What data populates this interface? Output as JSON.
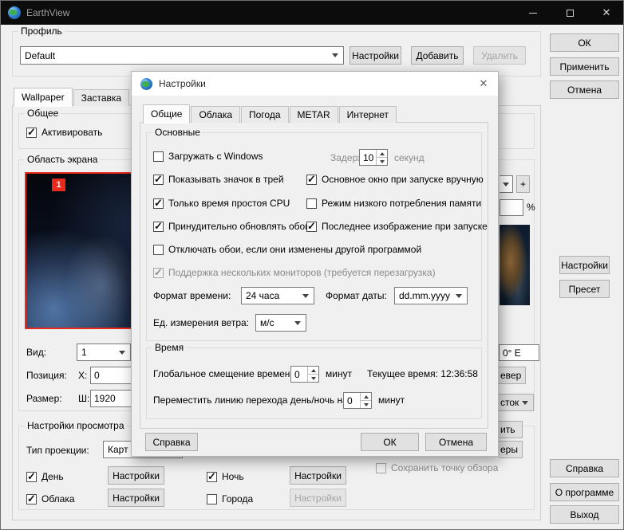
{
  "colors": {
    "titlebar": "#0c0c0c",
    "accent_red": "#e8291c",
    "window_bg": "#f0f0f0"
  },
  "window": {
    "title": "EarthView",
    "close": "✕"
  },
  "profile": {
    "label": "Профиль",
    "value": "Default",
    "settings": "Настройки",
    "add": "Добавить",
    "remove": "Удалить"
  },
  "side": {
    "ok": "ОК",
    "apply": "Применить",
    "cancel": "Отмена",
    "settings": "Настройки",
    "preset": "Пресет",
    "help": "Справка",
    "about": "О программе",
    "exit": "Выход"
  },
  "tabs": {
    "wallpaper": "Wallpaper",
    "screensaver": "Заставка"
  },
  "general": {
    "label": "Общее",
    "activate": "Активировать",
    "activate_checked": true
  },
  "screen_area": {
    "label": "Область экрана",
    "monitor_badge": "1",
    "view_label": "Вид:",
    "view_value": "1",
    "pos_label": "Позиция:",
    "x_label": "X:",
    "x_value": "0",
    "size_label": "Размер:",
    "w_label": "Ш:",
    "w_value": "1920"
  },
  "view_settings": {
    "label": "Настройки просмотра",
    "projection_label": "Тип проекции:",
    "projection_value": "Карт",
    "day": {
      "label": "День",
      "checked": true,
      "btn": "Настройки"
    },
    "clouds": {
      "label": "Облака",
      "checked": true,
      "btn": "Настройки"
    },
    "night": {
      "label": "Ночь",
      "checked": true,
      "btn": "Настройки"
    },
    "cities": {
      "label": "Города",
      "checked": false,
      "btn": "Настройки"
    }
  },
  "partials": {
    "plus": "+",
    "percent": "%",
    "coord": "0° E",
    "north": "евер",
    "east": "сток",
    "frag_1": "ить",
    "frag_2": "еры",
    "save_view": "Сохранить точку обзора",
    "save_view_checked": false
  },
  "dialog": {
    "title": "Настройки",
    "close": "✕",
    "tabs": [
      {
        "label": "Общие",
        "active": true
      },
      {
        "label": "Облака",
        "active": false
      },
      {
        "label": "Погода",
        "active": false
      },
      {
        "label": "METAR",
        "active": false
      },
      {
        "label": "Интернет",
        "active": false
      }
    ],
    "main": {
      "label": "Основные",
      "load_windows": {
        "label": "Загружать с Windows",
        "checked": false
      },
      "delay_label": "Задержка:",
      "delay_value": "10",
      "delay_unit": "секунд",
      "tray": {
        "label": "Показывать значок в трей",
        "checked": true
      },
      "main_manual": {
        "label": "Основное окно при запуске вручную",
        "checked": true
      },
      "cpu_idle": {
        "label": "Только время простоя CPU",
        "checked": true
      },
      "low_mem": {
        "label": "Режим низкого потребления памяти",
        "checked": false
      },
      "force_update": {
        "label": "Принудительно обновлять обои",
        "checked": true
      },
      "last_image": {
        "label": "Последнее изображение при запуске",
        "checked": true
      },
      "no_override": {
        "label": "Отключать обои, если они изменены другой программой",
        "checked": false
      },
      "multi_monitor": {
        "label": "Поддержка нескольких мониторов (требуется перезагрузка)",
        "checked": true
      },
      "time_format_label": "Формат времени:",
      "time_format_value": "24 часа",
      "date_format_label": "Формат даты:",
      "date_format_value": "dd.mm.yyyy",
      "wind_label": "Ед. измерения ветра:",
      "wind_value": "м/с"
    },
    "time": {
      "label": "Время",
      "offset_label": "Глобальное смещение времени:",
      "offset_value": "0",
      "offset_unit": "минут",
      "current": "Текущее время: 12:36:58",
      "shift_label": "Переместить линию перехода день/ночь на:",
      "shift_value": "0",
      "shift_unit": "минут"
    },
    "buttons": {
      "help": "Справка",
      "ok": "ОК",
      "cancel": "Отмена"
    }
  }
}
